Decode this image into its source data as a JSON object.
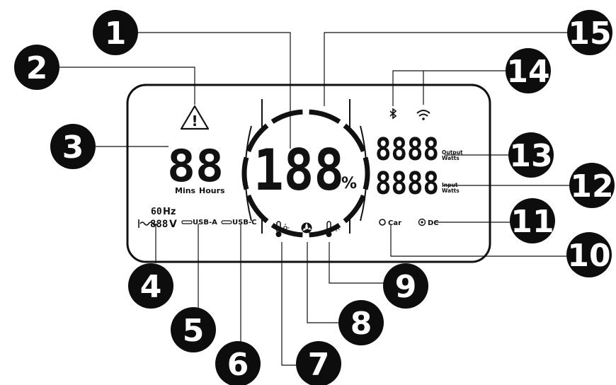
{
  "display": {
    "percent_digits": "188",
    "percent_unit": "%",
    "time_digits": "88",
    "time_unit_mins": "Mins",
    "time_unit_hours": "Hours",
    "hz_digits": "60",
    "hz_unit": "Hz",
    "volt_digits": "888",
    "volt_unit": "V",
    "usb_a": "USB-A",
    "usb_c": "USB-C",
    "output_digits": "8888",
    "output_label_1": "Output",
    "output_label_2": "Watts",
    "input_digits": "8888",
    "input_label_1": "Input",
    "input_label_2": "Watts",
    "car": "Car",
    "dc": "DC",
    "warning_symbol": "!"
  },
  "icons": [
    "warning-icon",
    "bluetooth-icon",
    "wifi-icon",
    "thermometer-hot-icon",
    "fan-icon",
    "thermometer-cold-icon",
    "car-indicator-icon",
    "dc-indicator-icon"
  ],
  "callouts": [
    "1",
    "2",
    "3",
    "4",
    "5",
    "6",
    "7",
    "8",
    "9",
    "10",
    "11",
    "12",
    "13",
    "14",
    "15"
  ],
  "colors": {
    "ink": "#111111",
    "badge": "#0d0d0d",
    "badge_text": "#ffffff",
    "background": "#ffffff"
  }
}
